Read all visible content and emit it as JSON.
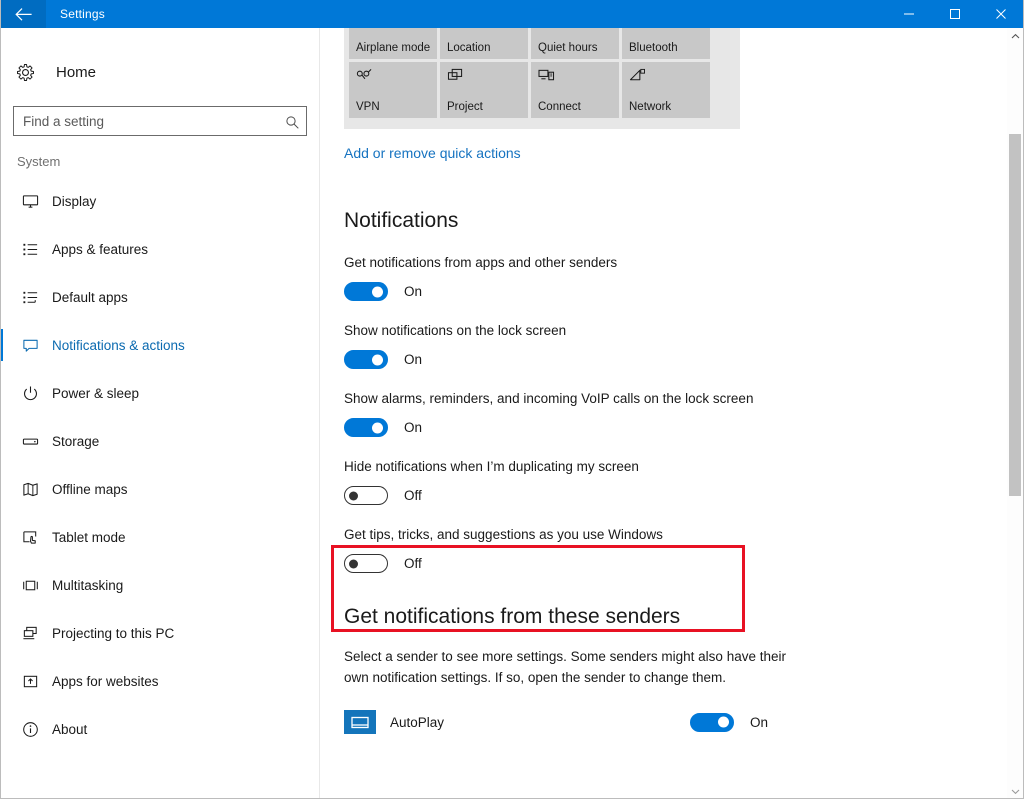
{
  "titlebar": {
    "title": "Settings",
    "back_icon": "back-arrow-icon",
    "minimize_icon": "minimize-icon",
    "maximize_icon": "maximize-icon",
    "close_icon": "close-icon",
    "accent_color": "#0078d7"
  },
  "sidebar": {
    "home_label": "Home",
    "home_icon": "gear-icon",
    "search": {
      "placeholder": "Find a setting",
      "value": "",
      "icon": "search-icon"
    },
    "group_label": "System",
    "items": [
      {
        "label": "Display",
        "icon": "monitor-icon",
        "selected": false
      },
      {
        "label": "Apps & features",
        "icon": "list-icon",
        "selected": false
      },
      {
        "label": "Default apps",
        "icon": "list-arrow-icon",
        "selected": false
      },
      {
        "label": "Notifications & actions",
        "icon": "speech-bubble-icon",
        "selected": true
      },
      {
        "label": "Power & sleep",
        "icon": "power-icon",
        "selected": false
      },
      {
        "label": "Storage",
        "icon": "drive-icon",
        "selected": false
      },
      {
        "label": "Offline maps",
        "icon": "map-icon",
        "selected": false
      },
      {
        "label": "Tablet mode",
        "icon": "tablet-touch-icon",
        "selected": false
      },
      {
        "label": "Multitasking",
        "icon": "multitask-icon",
        "selected": false
      },
      {
        "label": "Projecting to this PC",
        "icon": "project-pc-icon",
        "selected": false
      },
      {
        "label": "Apps for websites",
        "icon": "app-website-icon",
        "selected": false
      },
      {
        "label": "About",
        "icon": "info-icon",
        "selected": false
      }
    ],
    "selected_accent": "#0078d7",
    "selected_text_color": "#0b6ab0"
  },
  "quick_actions": {
    "row1": [
      {
        "label": "Airplane mode"
      },
      {
        "label": "Location"
      },
      {
        "label": "Quiet hours"
      },
      {
        "label": "Bluetooth"
      }
    ],
    "row2": [
      {
        "label": "VPN",
        "icon": "vpn-icon"
      },
      {
        "label": "Project",
        "icon": "project-icon"
      },
      {
        "label": "Connect",
        "icon": "connect-icon"
      },
      {
        "label": "Network",
        "icon": "network-icon"
      }
    ],
    "link_label": "Add or remove quick actions",
    "link_color": "#1673c0"
  },
  "notifications": {
    "heading": "Notifications",
    "settings": [
      {
        "label": "Get notifications from apps and other senders",
        "state": "On",
        "on": true,
        "highlighted": false
      },
      {
        "label": "Show notifications on the lock screen",
        "state": "On",
        "on": true,
        "highlighted": false
      },
      {
        "label": "Show alarms, reminders, and incoming VoIP calls on the lock screen",
        "state": "On",
        "on": true,
        "highlighted": false
      },
      {
        "label": "Hide notifications when I’m duplicating my screen",
        "state": "Off",
        "on": false,
        "highlighted": false
      },
      {
        "label": "Get tips, tricks, and suggestions as you use Windows",
        "state": "Off",
        "on": false,
        "highlighted": true
      }
    ]
  },
  "senders": {
    "heading": "Get notifications from these senders",
    "description": "Select a sender to see more settings. Some senders might also have their own notification settings. If so, open the sender to change them.",
    "list": [
      {
        "name": "AutoPlay",
        "icon": "autoplay-icon",
        "state": "On",
        "on": true
      }
    ]
  },
  "highlight": {
    "color": "#e81123"
  },
  "scrollbar": {
    "up_arrow_icon": "chevron-up-icon",
    "down_arrow_icon": "chevron-down-icon"
  }
}
